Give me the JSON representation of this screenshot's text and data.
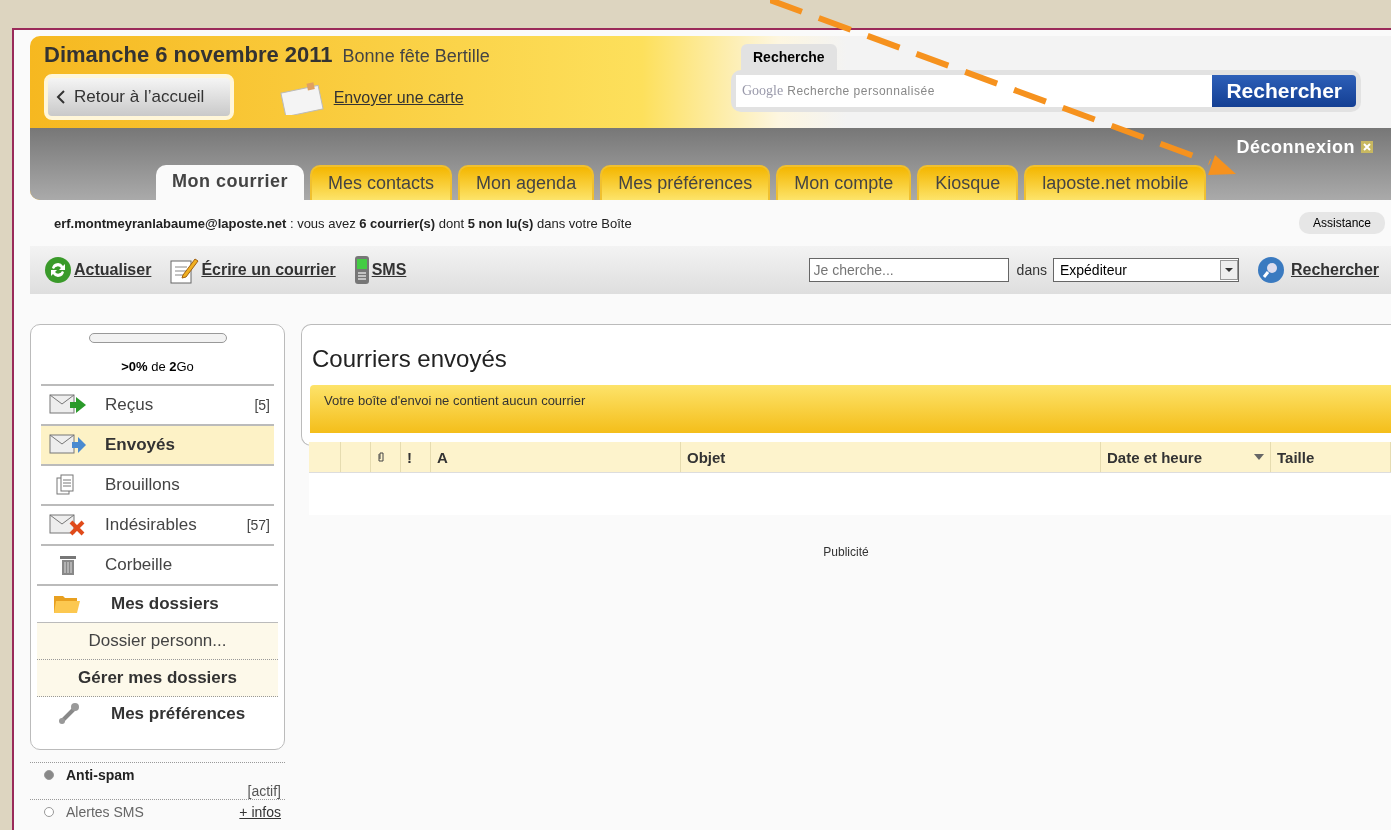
{
  "header": {
    "date": "Dimanche 6 novembre 2011",
    "fete": "Bonne fête Bertille",
    "back_button": "Retour à l’accueil",
    "card_link": "Envoyer une carte"
  },
  "search": {
    "tab": "Recherche",
    "logo": "Google",
    "placeholder": "Recherche personnalisée",
    "button": "Rechercher"
  },
  "logout": "Déconnexion",
  "tabs": [
    {
      "label": "Mon courrier",
      "selected": true
    },
    {
      "label": "Mes contacts",
      "selected": false
    },
    {
      "label": "Mon agenda",
      "selected": false
    },
    {
      "label": "Mes préférences",
      "selected": false
    },
    {
      "label": "Mon compte",
      "selected": false
    },
    {
      "label": "Kiosque",
      "selected": false
    },
    {
      "label": "laposte.net mobile",
      "selected": false
    }
  ],
  "status_line": "**erf.montmeyranlabaume@laposte.net** : vous avez **6 courrier(s)** dont  **5 non lu(s)** dans votre Boîte",
  "assistance": "Assistance",
  "toolbar": {
    "actions": [
      {
        "kind": "refresh",
        "label": "Actualiser"
      },
      {
        "kind": "write",
        "label": "Écrire un courrier"
      },
      {
        "kind": "sms",
        "label": "SMS"
      }
    ],
    "search_placeholder": "Je cherche...",
    "in_label": "dans",
    "field": "Expéditeur",
    "button": "Rechercher"
  },
  "storage": {
    "level": 0,
    "text": "**>0%** de **2**Go"
  },
  "folders": [
    {
      "kind": "inbox",
      "label": "Reçus",
      "count": "[5]",
      "selected": false
    },
    {
      "kind": "sent",
      "label": "Envoyés",
      "selected": true
    },
    {
      "kind": "drafts",
      "label": "Brouillons",
      "selected": false
    },
    {
      "kind": "spam",
      "label": "Indésirables",
      "count": "[57]",
      "selected": false
    },
    {
      "kind": "trash",
      "label": "Corbeille",
      "selected": false
    }
  ],
  "my_folders": {
    "title": "Mes dossiers",
    "items": [
      "Dossier personn..."
    ],
    "manage": "Gérer mes dossiers"
  },
  "preferences": "Mes préférences",
  "options": [
    {
      "label": "Anti-spam",
      "on": true,
      "status": "[actif]"
    },
    {
      "label": "Alertes SMS",
      "on": false,
      "link": "+ infos"
    }
  ],
  "main": {
    "title": "Courriers envoyés",
    "notice": "Votre boîte d'envoi ne contient aucun courrier",
    "columns": [
      {
        "kind": "blank"
      },
      {
        "kind": "blank"
      },
      {
        "kind": "attachment"
      },
      {
        "kind": "text",
        "label": "!"
      },
      {
        "kind": "text",
        "label": "A"
      },
      {
        "kind": "text",
        "label": "Objet"
      },
      {
        "kind": "sort",
        "label": "Date et heure"
      },
      {
        "kind": "text",
        "label": "Taille"
      }
    ],
    "ad": "Publicité"
  }
}
